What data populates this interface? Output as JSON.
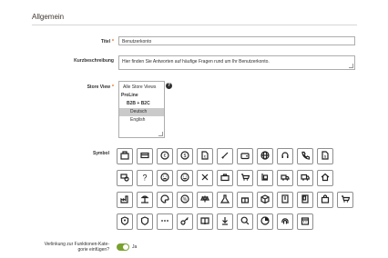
{
  "section": {
    "title": "Allgemein"
  },
  "fields": {
    "title": {
      "label": "Titel",
      "required_mark": "*",
      "value": "Benutzerkonto"
    },
    "short_description": {
      "label": "Kurzbeschreibung",
      "value": "Hier finden Sie Antworten auf häufige Fragen rund um Ihr Benutzerkonto."
    },
    "store_view": {
      "label": "Store View",
      "required_mark": "*",
      "help": "?",
      "options": [
        {
          "label": "Alle Store Views",
          "kind": "plain"
        },
        {
          "label": "ProLine",
          "kind": "group"
        },
        {
          "label": "B2B + B2C",
          "kind": "sub"
        },
        {
          "label": "Deutsch",
          "kind": "indent",
          "selected": true
        },
        {
          "label": "English",
          "kind": "indent",
          "selected": false
        }
      ]
    },
    "symbol": {
      "label": "Symbol",
      "icons": [
        "cash-register-icon",
        "credit-card-icon",
        "euro-coin-icon",
        "dollar-coin-icon",
        "invoice-euro-icon",
        "pencil-icon",
        "wallet-icon",
        "globe-icon",
        "headset-icon",
        "phone-icon",
        "document-dollar-icon",
        "money-clock-icon",
        "question-icon",
        "sad-face-icon",
        "smiley-face-icon",
        "tools-icon",
        "toolbox-icon",
        "cart-icon",
        "hand-truck-icon",
        "delivery-truck-icon",
        "truck-icon",
        "home-icon",
        "factory-icon",
        "beach-icon",
        "palette-icon",
        "percent-icon",
        "scale-icon",
        "flask-icon",
        "gift-icon",
        "box-icon",
        "building-icon",
        "vending-icon",
        "shopping-bag-icon",
        "cart-add-icon",
        "person-shield-icon",
        "shield-icon",
        "password-dots-icon",
        "key-icon",
        "book-icon",
        "download-icon",
        "search-icon",
        "pie-chart-icon",
        "fingerprint-icon",
        "calendar-icon"
      ]
    },
    "category_link": {
      "label_line1": "Verlinkung zur Funktionen-Kate-",
      "label_line2": "gorie einfügen?",
      "value_label": "Ja",
      "enabled": true
    }
  }
}
